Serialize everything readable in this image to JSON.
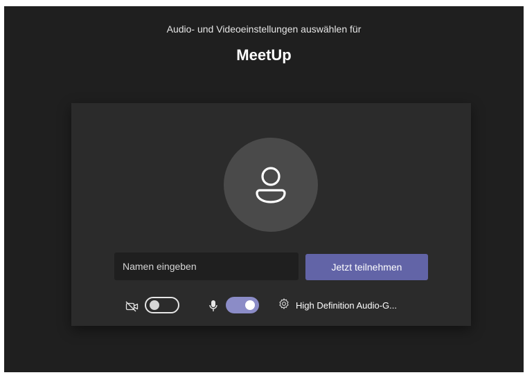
{
  "header": {
    "subtitle": "Audio- und Videoeinstellungen auswählen für",
    "title": "MeetUp"
  },
  "join": {
    "name_placeholder": "Namen eingeben",
    "join_label": "Jetzt teilnehmen"
  },
  "controls": {
    "camera": {
      "state": "off",
      "icon": "camera-off-icon"
    },
    "microphone": {
      "state": "on",
      "icon": "microphone-icon"
    },
    "device_settings_label": "High Definition Audio-G...",
    "device_settings_icon": "gear-icon"
  },
  "colors": {
    "background": "#1f1f1f",
    "card": "#2b2b2b",
    "accent": "#6264a7",
    "toggle_on": "#8b8cc7"
  }
}
